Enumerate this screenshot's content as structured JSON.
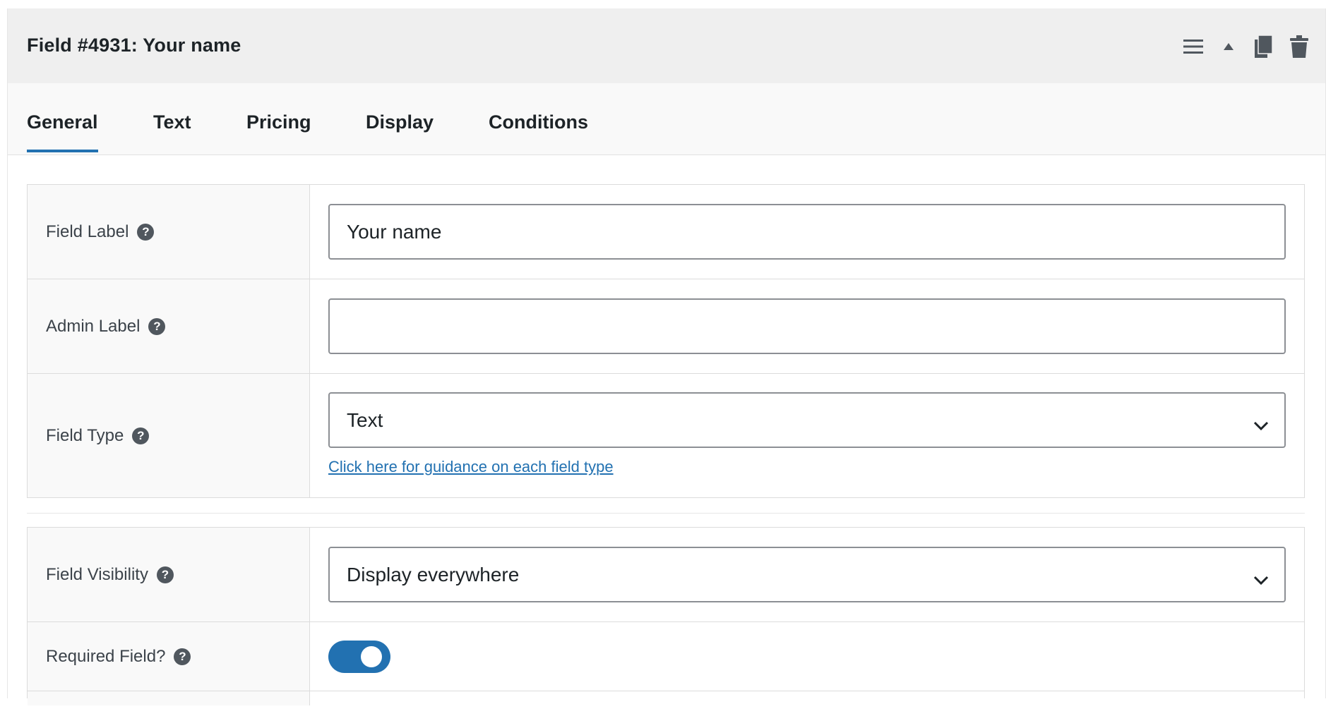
{
  "header": {
    "title": "Field #4931: Your name",
    "actions": [
      {
        "icon": "menu-icon",
        "label": "Reorder"
      },
      {
        "icon": "collapse-arrow-icon",
        "label": "Collapse"
      },
      {
        "icon": "duplicate-icon",
        "label": "Duplicate"
      },
      {
        "icon": "trash-icon",
        "label": "Delete"
      }
    ]
  },
  "tabs": [
    {
      "label": "General",
      "active": true
    },
    {
      "label": "Text",
      "active": false
    },
    {
      "label": "Pricing",
      "active": false
    },
    {
      "label": "Display",
      "active": false
    },
    {
      "label": "Conditions",
      "active": false
    }
  ],
  "help_glyph": "?",
  "fields": {
    "field_label": {
      "label": "Field Label",
      "value": "Your name"
    },
    "admin_label": {
      "label": "Admin Label",
      "value": ""
    },
    "field_type": {
      "label": "Field Type",
      "selected": "Text",
      "guidance_link": "Click here for guidance on each field type"
    },
    "field_visibility": {
      "label": "Field Visibility",
      "selected": "Display everywhere"
    },
    "required_field": {
      "label": "Required Field?",
      "enabled": true
    }
  },
  "colors": {
    "accent": "#2271b1",
    "header_bg": "#efefef",
    "label_bg": "#f9f9f9"
  }
}
